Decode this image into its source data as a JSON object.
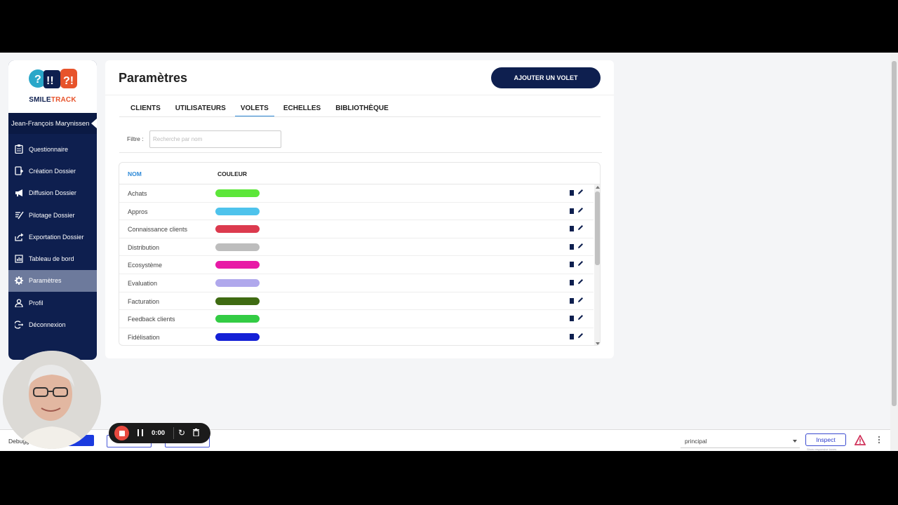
{
  "app": {
    "logo_text_smile": "SMILE",
    "logo_text_track": "TRACK",
    "user_name": "Jean-François Marynissen"
  },
  "sidebar": {
    "items": [
      {
        "label": "Questionnaire",
        "icon": "clipboard-icon"
      },
      {
        "label": "Création Dossier",
        "icon": "file-add-icon"
      },
      {
        "label": "Diffusion Dossier",
        "icon": "megaphone-icon"
      },
      {
        "label": "Pilotage Dossier",
        "icon": "steering-icon"
      },
      {
        "label": "Exportation Dossier",
        "icon": "export-icon"
      },
      {
        "label": "Tableau de bord",
        "icon": "dashboard-icon"
      },
      {
        "label": "Paramètres",
        "icon": "gear-icon",
        "active": true
      },
      {
        "label": "Profil",
        "icon": "user-icon"
      },
      {
        "label": "Déconnexion",
        "icon": "logout-icon"
      }
    ]
  },
  "header": {
    "title": "Paramètres",
    "add_button": "AJOUTER UN VOLET"
  },
  "tabs": [
    {
      "label": "CLIENTS"
    },
    {
      "label": "UTILISATEURS"
    },
    {
      "label": "VOLETS",
      "active": true
    },
    {
      "label": "ECHELLES"
    },
    {
      "label": "BIBLIOTHÈQUE"
    }
  ],
  "filter": {
    "label": "Filtre :",
    "placeholder": "Recherche par nom",
    "value": ""
  },
  "table": {
    "columns": [
      "NOM",
      "COULEUR"
    ],
    "rows": [
      {
        "name": "Achats",
        "color": "#5de63a"
      },
      {
        "name": "Appros",
        "color": "#4ec3ec"
      },
      {
        "name": "Connaissance clients",
        "color": "#dc3a4e"
      },
      {
        "name": "Distribution",
        "color": "#bdbdbd"
      },
      {
        "name": "Ecosystème",
        "color": "#e81aa6"
      },
      {
        "name": "Evaluation",
        "color": "#b0a8ec"
      },
      {
        "name": "Facturation",
        "color": "#3f6b12"
      },
      {
        "name": "Feedback clients",
        "color": "#33cc44"
      },
      {
        "name": "Fidélisation",
        "color": "#1420d6"
      }
    ]
  },
  "devbar": {
    "debug_label": "Debugg",
    "select_value": "principal",
    "inspect_label": "Inspect",
    "inspect_sub": "Show responsive boxes"
  },
  "recorder": {
    "time": "0:00"
  },
  "colors": {
    "navy": "#0e1f4f",
    "accent_blue": "#2e8ad8",
    "logo_orange": "#e7532b",
    "logo_teal": "#2aa7c9"
  }
}
